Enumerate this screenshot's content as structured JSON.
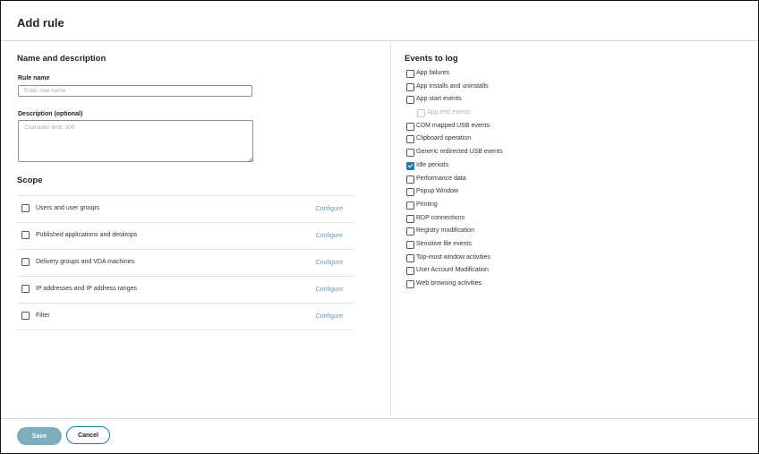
{
  "dialog": {
    "title": "Add rule"
  },
  "name_section": {
    "title": "Name and description",
    "rule_name_label": "Rule name",
    "rule_name_placeholder": "Enter rule name",
    "rule_name_value": "",
    "description_label": "Description (optional)",
    "description_placeholder": "Character limit: 300",
    "description_value": ""
  },
  "scope": {
    "title": "Scope",
    "rows": [
      {
        "label": "Users and user groups",
        "action": "Configure",
        "checked": false
      },
      {
        "label": "Published applications and desktops",
        "action": "Configure",
        "checked": false
      },
      {
        "label": "Delivery groups and VDA machines",
        "action": "Configure",
        "checked": false
      },
      {
        "label": "IP addresses and IP address ranges",
        "action": "Configure",
        "checked": false
      },
      {
        "label": "Filter",
        "action": "Configure",
        "checked": false
      }
    ]
  },
  "events": {
    "title": "Events to log",
    "items": [
      {
        "label": "App failures",
        "checked": false
      },
      {
        "label": "App installs and uninstalls",
        "checked": false
      },
      {
        "label": "App start events",
        "checked": false
      },
      {
        "label": "App end events",
        "checked": false,
        "disabled": true,
        "indented": true
      },
      {
        "label": "CDM mapped USB events",
        "checked": false
      },
      {
        "label": "Clipboard operation",
        "checked": false
      },
      {
        "label": "Generic redirected USB events",
        "checked": false
      },
      {
        "label": "Idle periods",
        "checked": true
      },
      {
        "label": "Performance data",
        "checked": false
      },
      {
        "label": "Popup Window",
        "checked": false
      },
      {
        "label": "Printing",
        "checked": false
      },
      {
        "label": "RDP connections",
        "checked": false
      },
      {
        "label": "Registry modification",
        "checked": false
      },
      {
        "label": "Sensitive file events",
        "checked": false
      },
      {
        "label": "Top-most window activities",
        "checked": false
      },
      {
        "label": "User Account Modification",
        "checked": false
      },
      {
        "label": "Web browsing activities",
        "checked": false
      }
    ]
  },
  "footer": {
    "save_label": "Save",
    "cancel_label": "Cancel"
  },
  "colors": {
    "accent": "#207da3",
    "link": "#5a9fb5",
    "save_button": "#7bafbd"
  }
}
